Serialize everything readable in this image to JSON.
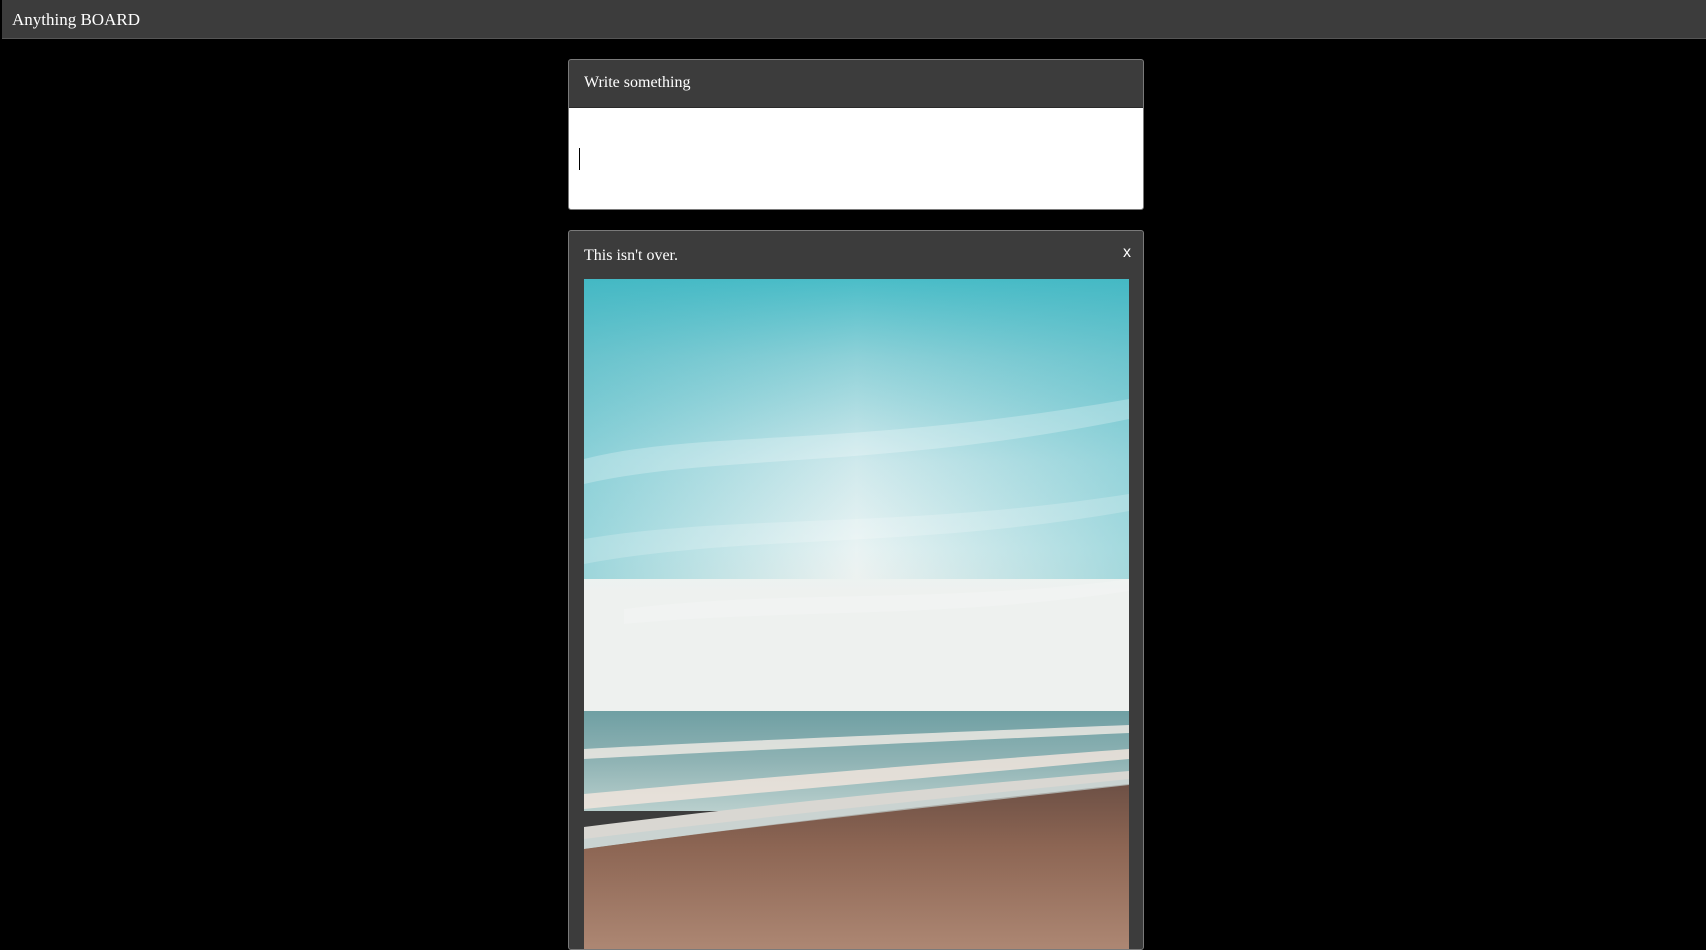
{
  "app": {
    "title": "Anything BOARD"
  },
  "composer": {
    "header": "Write something",
    "value": ""
  },
  "posts": [
    {
      "text": "This isn't over.",
      "close_label": "x",
      "image": {
        "subject": "beach-seascape-photo"
      }
    }
  ],
  "colors": {
    "page_bg": "#000000",
    "bar_bg": "#3c3c3c",
    "card_bg": "#3c3c3c",
    "text": "#ffffff",
    "input_bg": "#ffffff"
  }
}
